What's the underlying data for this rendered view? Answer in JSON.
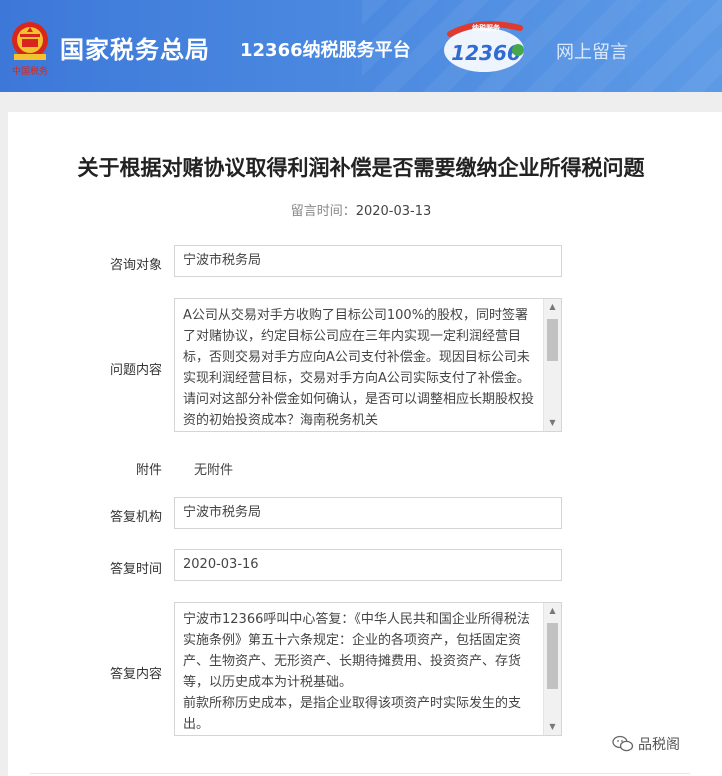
{
  "header": {
    "org_name": "国家税务总局",
    "platform_name": "12366纳税服务平台",
    "logo_12366_text": "12366",
    "logo_badge_text": "纳税服务",
    "emblem_caption": "中国税务",
    "nav_link": "网上留言"
  },
  "question": {
    "title": "关于根据对赌协议取得利润补偿是否需要缴纳企业所得税问题",
    "time_label": "留言时间：",
    "time_value": "2020-03-13"
  },
  "form": {
    "consult_target_label": "咨询对象",
    "consult_target_value": "宁波市税务局",
    "question_label": "问题内容",
    "question_text": "A公司从交易对手方收购了目标公司100%的股权，同时签署了对赌协议，约定目标公司应在三年内实现一定利润经营目标，否则交易对手方应向A公司支付补偿金。现因目标公司未实现利润经营目标，交易对手方向A公司实际支付了补偿金。请问对这部分补偿金如何确认，是否可以调整相应长期股权投资的初始投资成本？海南税务机关",
    "attachment_label": "附件",
    "attachment_value": "无附件",
    "reply_org_label": "答复机构",
    "reply_org_value": "宁波市税务局",
    "reply_time_label": "答复时间",
    "reply_time_value": "2020-03-16",
    "reply_content_label": "答复内容",
    "reply_text_p1": "宁波市12366呼叫中心答复：《中华人民共和国企业所得税法实施条例》第五十六条规定：企业的各项资产，包括固定资产、生物资产、无形资产、长期待摊费用、投资资产、存货等，以历史成本为计税基础。",
    "reply_text_p2": "前款所称历史成本，是指企业取得该项资产时实际发生的支出。"
  },
  "watermark": {
    "text": "品税阁",
    "icon": "wechat-icon"
  },
  "colors": {
    "header_blue": "#3d78d9",
    "emblem_red": "#d9261c",
    "text_dark": "#222222"
  }
}
